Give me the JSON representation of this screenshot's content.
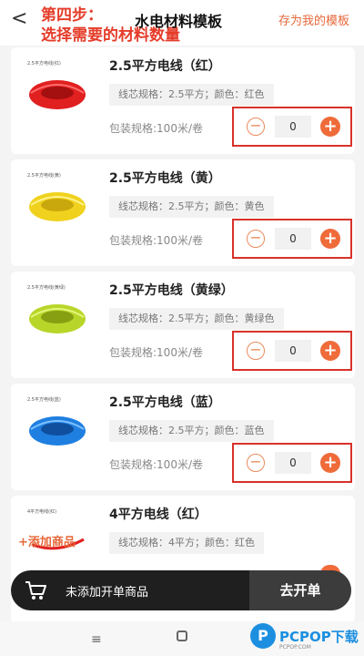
{
  "header": {
    "back_glyph": "<",
    "step_line1": "第四步：",
    "step_line2": "选择需要的材料数量",
    "title": "水电材料模板",
    "save_template": "存为我的模板"
  },
  "products": [
    {
      "thumb_tag": "2.5平方电线(红)",
      "coil_color": "#e12020",
      "name": "2.5平方电线（红）",
      "spec": "线芯规格：2.5平方；颜色：红色",
      "pack": "包装规格:100米/卷",
      "qty": "0"
    },
    {
      "thumb_tag": "2.5平方电线(黄)",
      "coil_color": "#f0d21e",
      "name": "2.5平方电线（黄）",
      "spec": "线芯规格：2.5平方；颜色：黄色",
      "pack": "包装规格:100米/卷",
      "qty": "0"
    },
    {
      "thumb_tag": "2.5平方电线(黄绿)",
      "coil_color": "#b8d62a",
      "name": "2.5平方电线（黄绿）",
      "spec": "线芯规格：2.5平方；颜色：黄绿色",
      "pack": "包装规格:100米/卷",
      "qty": "0"
    },
    {
      "thumb_tag": "2.5平方电线(蓝)",
      "coil_color": "#1f7fe0",
      "name": "2.5平方电线（蓝）",
      "spec": "线芯规格：2.5平方；颜色：蓝色",
      "pack": "包装规格:100米/卷",
      "qty": "0"
    },
    {
      "thumb_tag": "4平方电线(红)",
      "coil_color": "#e12020",
      "name": "4平方电线（红）",
      "spec": "线芯规格：4平方；颜色：红色",
      "pack": "",
      "qty": ""
    }
  ],
  "stepper": {
    "minus": "−",
    "plus": "+"
  },
  "add_product": "+添加商品",
  "bottom_bar": {
    "cart_text": "未添加开单商品",
    "checkout": "去开单"
  },
  "navbar": {
    "menu_glyph": "≡"
  },
  "watermark": {
    "logo_letter": "P",
    "logo_text": "PCPOP下载",
    "logo_sub": "PCPOP.COM"
  }
}
